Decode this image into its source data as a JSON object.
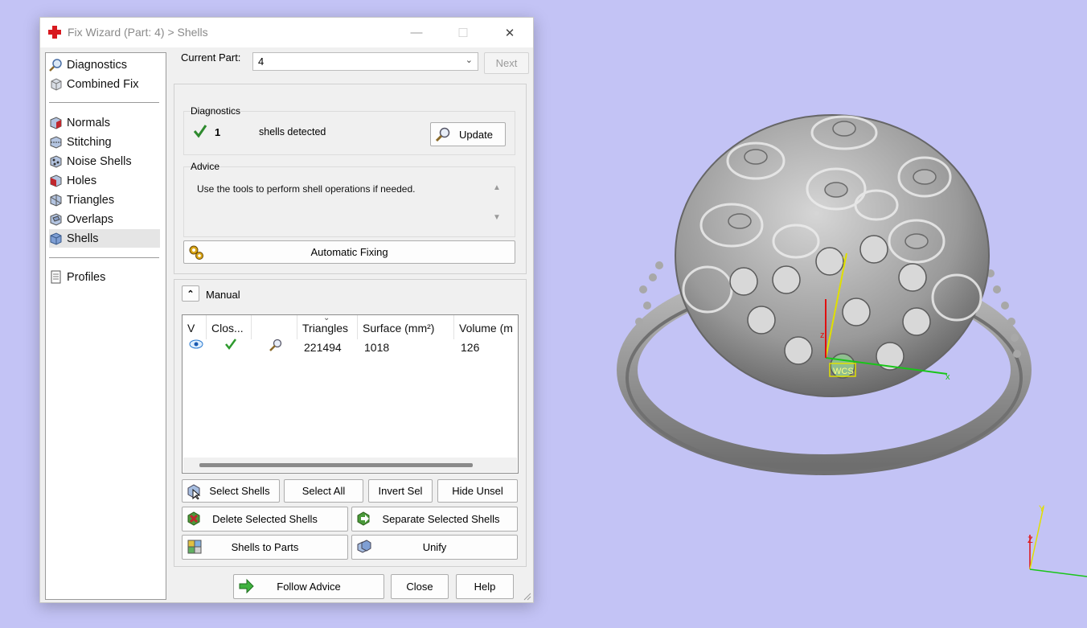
{
  "window": {
    "title": "Fix Wizard (Part: 4) > Shells",
    "minimize": "—",
    "maximize": "☐",
    "close": "✕"
  },
  "sidebar": {
    "items": [
      {
        "label": "Diagnostics",
        "icon": "magnifier-icon"
      },
      {
        "label": "Combined Fix",
        "icon": "cube-icon"
      },
      {
        "label": "Normals",
        "icon": "normals-icon"
      },
      {
        "label": "Stitching",
        "icon": "stitching-icon"
      },
      {
        "label": "Noise Shells",
        "icon": "noise-shells-icon"
      },
      {
        "label": "Holes",
        "icon": "holes-icon"
      },
      {
        "label": "Triangles",
        "icon": "triangles-icon"
      },
      {
        "label": "Overlaps",
        "icon": "overlaps-icon"
      },
      {
        "label": "Shells",
        "icon": "shells-icon",
        "active": true
      },
      {
        "label": "Profiles",
        "icon": "document-icon"
      }
    ]
  },
  "current_part": {
    "label": "Current Part:",
    "value": "4",
    "next_label": "Next"
  },
  "diagnostics": {
    "group_label": "Diagnostics",
    "count": "1",
    "status_text": "shells detected",
    "update_label": "Update"
  },
  "advice": {
    "group_label": "Advice",
    "text": "Use the tools to perform shell operations if needed."
  },
  "automatic_fixing_label": "Automatic Fixing",
  "manual": {
    "label": "Manual",
    "collapse_glyph": "⌃"
  },
  "table": {
    "headers": [
      "V",
      "Clos...",
      "",
      "Triangles",
      "Surface (mm²)",
      "Volume (m"
    ],
    "rows": [
      {
        "triangles": "221494",
        "surface": "1018",
        "volume": "126"
      }
    ]
  },
  "buttons": {
    "select_shells": "Select Shells",
    "select_all": "Select All",
    "invert_sel": "Invert Sel",
    "hide_unsel": "Hide Unsel",
    "delete_selected": "Delete Selected Shells",
    "separate_selected": "Separate Selected Shells",
    "shells_to_parts": "Shells to Parts",
    "unify": "Unify",
    "follow_advice": "Follow Advice",
    "close": "Close",
    "help": "Help"
  },
  "viewport": {
    "wcs_label": "WCS",
    "axis_x": "x",
    "axis_y": "y",
    "axis_z": "z",
    "mini_axis_y": "Y",
    "mini_axis_z": "Z"
  },
  "colors": {
    "viewport_bg": "#c3c3f5",
    "check_green": "#2e9a2e",
    "ring_gray": "#8c8c8c"
  }
}
